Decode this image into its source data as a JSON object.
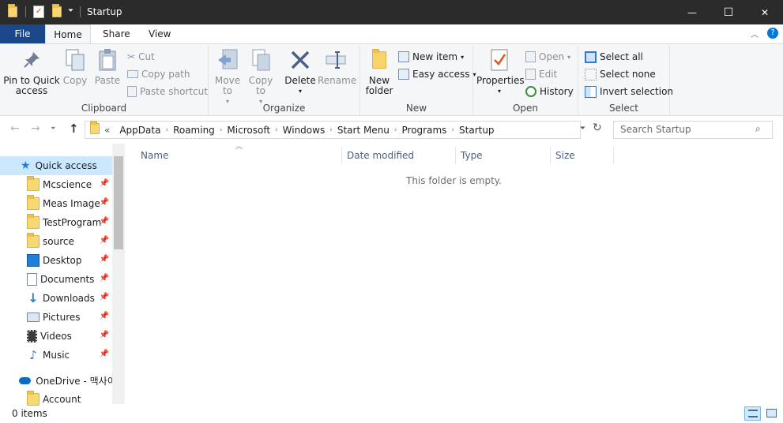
{
  "window": {
    "title": "Startup",
    "minimize_glyph": "—",
    "maximize_glyph": "☐",
    "close_glyph": "✕"
  },
  "tabs": {
    "file": "File",
    "home": "Home",
    "share": "Share",
    "view": "View"
  },
  "ribbon": {
    "clipboard": {
      "label": "Clipboard",
      "pin": "Pin to Quick access",
      "copy": "Copy",
      "paste": "Paste",
      "cut": "Cut",
      "copy_path": "Copy path",
      "paste_shortcut": "Paste shortcut"
    },
    "organize": {
      "label": "Organize",
      "move_to": "Move to",
      "copy_to": "Copy to",
      "delete": "Delete",
      "rename": "Rename"
    },
    "new": {
      "label": "New",
      "new_folder": "New folder",
      "new_item": "New item",
      "easy_access": "Easy access"
    },
    "open": {
      "label": "Open",
      "properties": "Properties",
      "open": "Open",
      "edit": "Edit",
      "history": "History"
    },
    "select": {
      "label": "Select",
      "select_all": "Select all",
      "select_none": "Select none",
      "invert": "Invert selection"
    }
  },
  "address": {
    "prefix": "«",
    "crumbs": [
      "AppData",
      "Roaming",
      "Microsoft",
      "Windows",
      "Start Menu",
      "Programs",
      "Startup"
    ]
  },
  "search": {
    "placeholder": "Search Startup"
  },
  "nav": {
    "quick_access": "Quick access",
    "items": [
      "Mcscience",
      "Meas Image",
      "TestProgram",
      "source",
      "Desktop",
      "Documents",
      "Downloads",
      "Pictures",
      "Videos",
      "Music"
    ],
    "onedrive": "OneDrive - 맥사이",
    "account": "Account"
  },
  "columns": {
    "name": "Name",
    "date": "Date modified",
    "type": "Type",
    "size": "Size"
  },
  "empty_message": "This folder is empty.",
  "status": {
    "items": "0 items"
  },
  "colors": {
    "titlebar": "#2b2b2b",
    "file_tab": "#19478a",
    "accent": "#0078d7",
    "folder": "#f8d775"
  }
}
